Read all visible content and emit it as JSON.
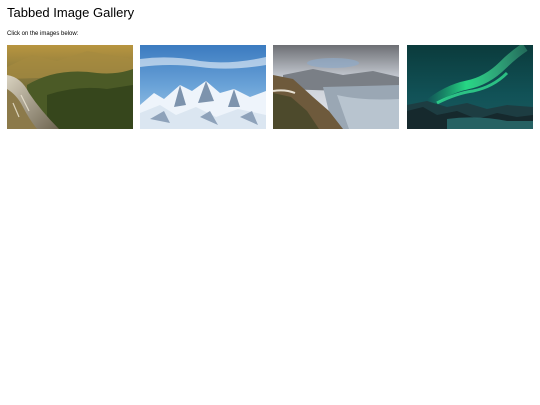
{
  "page": {
    "title": "Tabbed Image Gallery",
    "instructions": "Click on the images below:"
  },
  "gallery": {
    "images": [
      {
        "subject": "forest mountain valley at sunrise",
        "icon": "image-forest-mountains"
      },
      {
        "subject": "snowy mountain peaks under blue sky",
        "icon": "image-snow-mountains"
      },
      {
        "subject": "mountain road above lake",
        "icon": "image-mountain-lake"
      },
      {
        "subject": "northern lights over landscape",
        "icon": "image-northern-lights"
      }
    ]
  },
  "colors": {
    "background": "#ffffff",
    "text": "#000000"
  }
}
